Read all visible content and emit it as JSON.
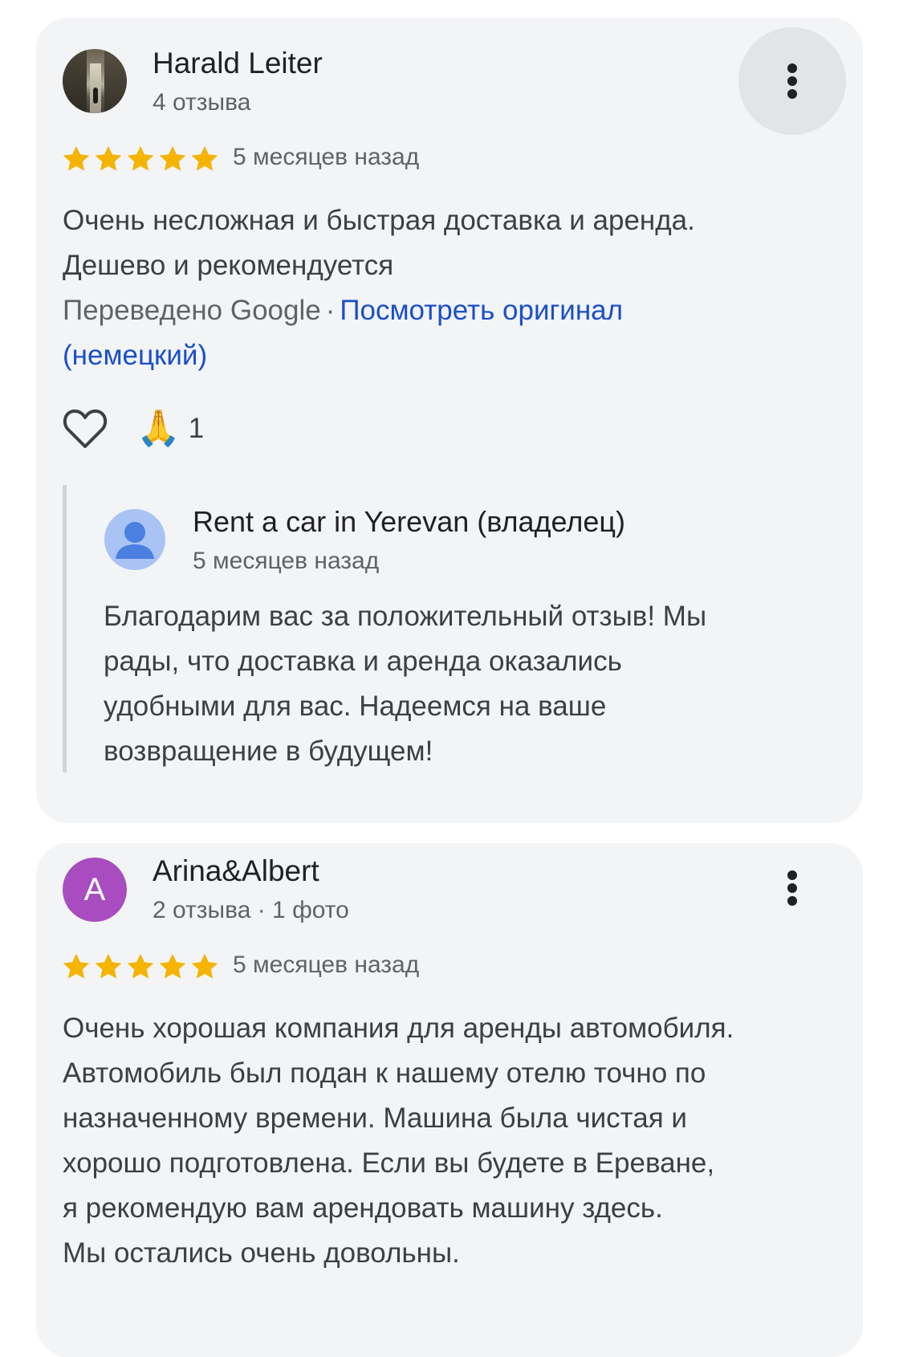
{
  "reviews": [
    {
      "author": "Harald Leiter",
      "meta": "4 отзыва",
      "rating": 5,
      "date": "5 месяцев назад",
      "text_lines": [
        "Очень несложная и быстрая доставка и аренда.",
        "Дешево и рекомендуется"
      ],
      "translated_label": "Переведено Google",
      "separator": "·",
      "original_link_line1": "Посмотреть оригинал",
      "original_link_line2": "(немецкий)",
      "reaction_emoji": "🙏",
      "reaction_count": "1",
      "avatar_icon": "street-photo",
      "more_icon": "more-vertical-icon",
      "like_icon": "heart-outline-icon",
      "owner_reply": {
        "name": "Rent a car in Yerevan (владелец)",
        "date": "5 месяцев назад",
        "text_lines": [
          "Благодарим вас за положительный отзыв! Мы",
          "рады, что доставка и аренда оказались",
          "удобными для вас. Надеемся на ваше",
          "возвращение в будущем!"
        ],
        "avatar_icon": "person-icon"
      }
    },
    {
      "author": "Arina&Albert",
      "meta": "2 отзыва · 1 фото",
      "avatar_letter": "A",
      "rating": 5,
      "date": "5 месяцев назад",
      "text_lines": [
        "Очень хорошая компания для аренды автомобиля.",
        "Автомобиль был подан к нашему отелю точно по",
        "назначенному времени. Машина была чистая и",
        "хорошо подготовлена. Если вы будете в Ереване,",
        "я рекомендую вам арендовать машину здесь.",
        "Мы остались очень довольны."
      ],
      "more_icon": "more-vertical-icon"
    }
  ],
  "colors": {
    "card_bg": "#f3f4f6",
    "star": "#f4b400",
    "link": "#1a4fc9",
    "avatar_letter_bg": "#a84cbf",
    "owner_avatar_bg": "#a9c3f4",
    "owner_avatar_fg": "#4b7fe0"
  }
}
